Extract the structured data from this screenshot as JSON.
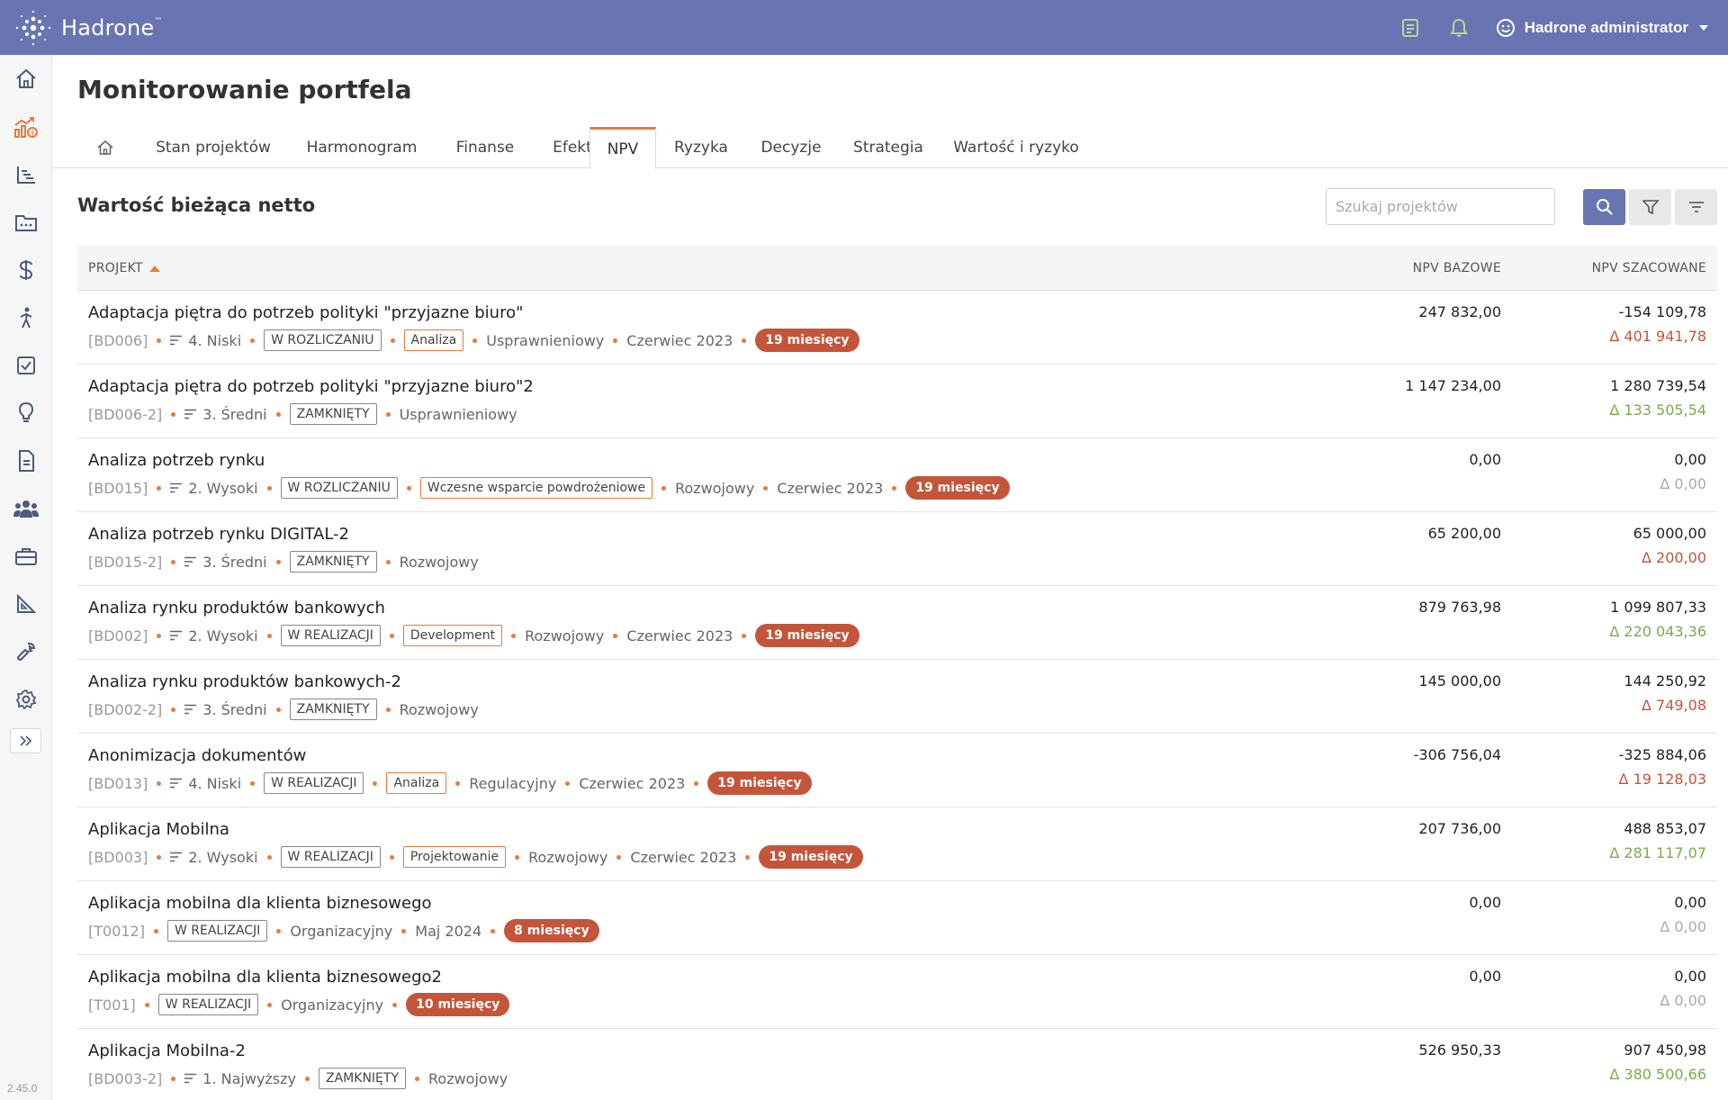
{
  "app": {
    "logo_text": "Hadrone",
    "logo_tm": "™",
    "user_name": "Hadrone administrator",
    "version": "2.45.0"
  },
  "colors": {
    "brand": "#6875b2",
    "accent": "#e87a3c",
    "badge": "#c4553a",
    "positive": "#7cab4a",
    "negative": "#c4553a"
  },
  "page": {
    "title": "Monitorowanie portfela",
    "section_title": "Wartość bieżąca netto",
    "search_placeholder": "Szukaj projektów"
  },
  "tabs": [
    {
      "label": "",
      "icon": "home-icon"
    },
    {
      "label": "Stan projektów"
    },
    {
      "label": "Harmonogram"
    },
    {
      "label": "Finanse"
    },
    {
      "label": "Efekty"
    },
    {
      "label": "NPV",
      "active": true
    },
    {
      "label": "Ryzyka"
    },
    {
      "label": "Decyzje"
    },
    {
      "label": "Strategia"
    },
    {
      "label": "Wartość i ryzyko"
    }
  ],
  "sidebar": [
    {
      "icon": "home-icon"
    },
    {
      "icon": "portfolio-chart-icon",
      "active": true
    },
    {
      "icon": "gantt-icon"
    },
    {
      "icon": "folder-icon"
    },
    {
      "icon": "dollar-icon"
    },
    {
      "icon": "person-walking-icon"
    },
    {
      "icon": "checkbox-icon"
    },
    {
      "icon": "lightbulb-icon"
    },
    {
      "icon": "document-icon"
    },
    {
      "icon": "people-icon"
    },
    {
      "icon": "toolbox-icon"
    },
    {
      "icon": "ruler-triangle-icon"
    },
    {
      "icon": "wrench-icon"
    },
    {
      "icon": "settings-icon"
    }
  ],
  "table": {
    "columns": {
      "project": "PROJEKT",
      "npv_base": "NPV BAZOWE",
      "npv_est": "NPV SZACOWANE"
    },
    "rows": [
      {
        "name": "Adaptacja piętra do potrzeb polityki \"przyjazne biuro\"",
        "code": "[BD006]",
        "priority": "4. Niski",
        "status": "W ROZLICZANIU",
        "phase": "Analiza",
        "type": "Usprawnieniowy",
        "date": "Czerwiec 2023",
        "months": "19 miesięcy",
        "npv_base": "247 832,00",
        "npv_est": "-154 109,78",
        "delta": "Δ 401 941,78",
        "delta_kind": "neg"
      },
      {
        "name": "Adaptacja piętra do potrzeb polityki \"przyjazne biuro\"2",
        "code": "[BD006-2]",
        "priority": "3. Średni",
        "status": "ZAMKNIĘTY",
        "phase": "",
        "type": "Usprawnieniowy",
        "date": "",
        "months": "",
        "npv_base": "1 147 234,00",
        "npv_est": "1 280 739,54",
        "delta": "Δ 133 505,54",
        "delta_kind": "pos"
      },
      {
        "name": "Analiza potrzeb rynku",
        "code": "[BD015]",
        "priority": "2. Wysoki",
        "status": "W ROZLICZANIU",
        "phase": "Wczesne wsparcie powdrożeniowe",
        "type": "Rozwojowy",
        "date": "Czerwiec 2023",
        "months": "19 miesięcy",
        "npv_base": "0,00",
        "npv_est": "0,00",
        "delta": "Δ 0,00",
        "delta_kind": "zero"
      },
      {
        "name": "Analiza potrzeb rynku DIGITAL-2",
        "code": "[BD015-2]",
        "priority": "3. Średni",
        "status": "ZAMKNIĘTY",
        "phase": "",
        "type": "Rozwojowy",
        "date": "",
        "months": "",
        "npv_base": "65 200,00",
        "npv_est": "65 000,00",
        "delta": "Δ 200,00",
        "delta_kind": "neg"
      },
      {
        "name": "Analiza rynku produktów bankowych",
        "code": "[BD002]",
        "priority": "2. Wysoki",
        "status": "W REALIZACJI",
        "phase": "Development",
        "type": "Rozwojowy",
        "date": "Czerwiec 2023",
        "months": "19 miesięcy",
        "npv_base": "879 763,98",
        "npv_est": "1 099 807,33",
        "delta": "Δ 220 043,36",
        "delta_kind": "pos"
      },
      {
        "name": "Analiza rynku produktów bankowych-2",
        "code": "[BD002-2]",
        "priority": "3. Średni",
        "status": "ZAMKNIĘTY",
        "phase": "",
        "type": "Rozwojowy",
        "date": "",
        "months": "",
        "npv_base": "145 000,00",
        "npv_est": "144 250,92",
        "delta": "Δ 749,08",
        "delta_kind": "neg"
      },
      {
        "name": "Anonimizacja dokumentów",
        "code": "[BD013]",
        "priority": "4. Niski",
        "status": "W REALIZACJI",
        "phase": "Analiza",
        "type": "Regulacyjny",
        "date": "Czerwiec 2023",
        "months": "19 miesięcy",
        "npv_base": "-306 756,04",
        "npv_est": "-325 884,06",
        "delta": "Δ 19 128,03",
        "delta_kind": "neg"
      },
      {
        "name": "Aplikacja Mobilna",
        "code": "[BD003]",
        "priority": "2. Wysoki",
        "status": "W REALIZACJI",
        "phase": "Projektowanie",
        "type": "Rozwojowy",
        "date": "Czerwiec 2023",
        "months": "19 miesięcy",
        "npv_base": "207 736,00",
        "npv_est": "488 853,07",
        "delta": "Δ 281 117,07",
        "delta_kind": "pos"
      },
      {
        "name": "Aplikacja mobilna dla klienta biznesowego",
        "code": "[T0012]",
        "priority": "",
        "status": "W REALIZACJI",
        "phase": "",
        "type": "Organizacyjny",
        "date": "Maj 2024",
        "months": "8 miesięcy",
        "npv_base": "0,00",
        "npv_est": "0,00",
        "delta": "Δ 0,00",
        "delta_kind": "zero"
      },
      {
        "name": "Aplikacja mobilna dla klienta biznesowego2",
        "code": "[T001]",
        "priority": "",
        "status": "W REALIZACJI",
        "phase": "",
        "type": "Organizacyjny",
        "date": "",
        "months": "10 miesięcy",
        "npv_base": "0,00",
        "npv_est": "0,00",
        "delta": "Δ 0,00",
        "delta_kind": "zero"
      },
      {
        "name": "Aplikacja Mobilna-2",
        "code": "[BD003-2]",
        "priority": "1. Najwyższy",
        "status": "ZAMKNIĘTY",
        "phase": "",
        "type": "Rozwojowy",
        "date": "",
        "months": "",
        "npv_base": "526 950,33",
        "npv_est": "907 450,98",
        "delta": "Δ 380 500,66",
        "delta_kind": "pos"
      }
    ]
  }
}
